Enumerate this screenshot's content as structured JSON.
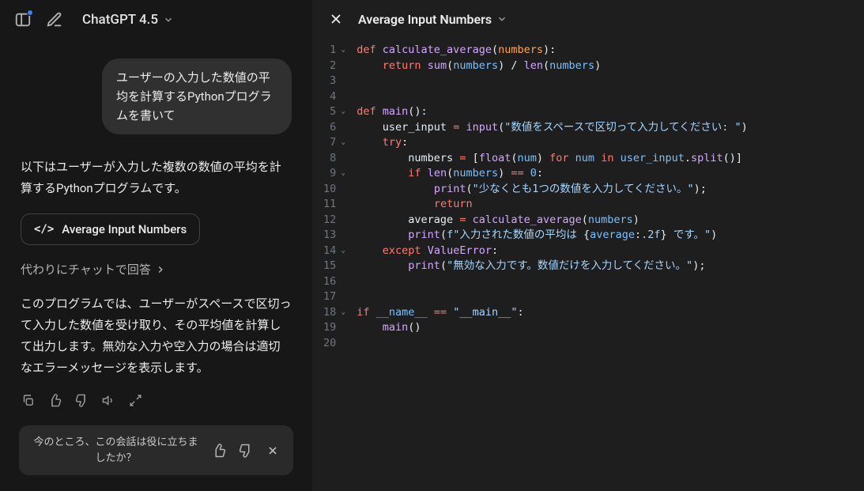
{
  "header": {
    "model": "ChatGPT 4.5"
  },
  "conversation": {
    "user_message": "ユーザーの入力した数値の平均を計算するPythonプログラムを書いて",
    "assistant_intro": "以下はユーザーが入力した複数の数値の平均を計算するPythonプログラムです。",
    "code_card_title": "Average Input Numbers",
    "chat_link": "代わりにチャットで回答",
    "assistant_desc": "このプログラムでは、ユーザーがスペースで区切って入力した数値を受け取り、その平均値を計算して出力します。無効な入力や空入力の場合は適切なエラーメッセージを表示します。"
  },
  "feedback": {
    "text": "今のところ、この会話は役に立ちましたか？"
  },
  "panel": {
    "title": "Average Input Numbers"
  },
  "code": {
    "lines": [
      {
        "n": 1,
        "fold": true,
        "tokens": [
          {
            "t": "def ",
            "c": "kw"
          },
          {
            "t": "calculate_average",
            "c": "fn"
          },
          {
            "t": "(",
            "c": "punc"
          },
          {
            "t": "numbers",
            "c": "param"
          },
          {
            "t": "):",
            "c": "punc"
          }
        ]
      },
      {
        "n": 2,
        "tokens": [
          {
            "t": "    ",
            "c": ""
          },
          {
            "t": "return ",
            "c": "kw"
          },
          {
            "t": "sum",
            "c": "fn"
          },
          {
            "t": "(",
            "c": "punc"
          },
          {
            "t": "numbers",
            "c": "var"
          },
          {
            "t": ") / ",
            "c": "punc"
          },
          {
            "t": "len",
            "c": "fn"
          },
          {
            "t": "(",
            "c": "punc"
          },
          {
            "t": "numbers",
            "c": "var"
          },
          {
            "t": ")",
            "c": "punc"
          }
        ]
      },
      {
        "n": 3,
        "tokens": []
      },
      {
        "n": 4,
        "tokens": []
      },
      {
        "n": 5,
        "fold": true,
        "tokens": [
          {
            "t": "def ",
            "c": "kw"
          },
          {
            "t": "main",
            "c": "fn"
          },
          {
            "t": "():",
            "c": "punc"
          }
        ]
      },
      {
        "n": 6,
        "tokens": [
          {
            "t": "    user_input ",
            "c": "name"
          },
          {
            "t": "= ",
            "c": "op"
          },
          {
            "t": "input",
            "c": "fn"
          },
          {
            "t": "(",
            "c": "punc"
          },
          {
            "t": "\"数値をスペースで区切って入力してください: \"",
            "c": "str"
          },
          {
            "t": ")",
            "c": "punc"
          }
        ]
      },
      {
        "n": 7,
        "fold": true,
        "tokens": [
          {
            "t": "    ",
            "c": ""
          },
          {
            "t": "try",
            "c": "kw"
          },
          {
            "t": ":",
            "c": "punc"
          }
        ]
      },
      {
        "n": 8,
        "tokens": [
          {
            "t": "        numbers ",
            "c": "name"
          },
          {
            "t": "= ",
            "c": "op"
          },
          {
            "t": "[",
            "c": "punc"
          },
          {
            "t": "float",
            "c": "fn"
          },
          {
            "t": "(",
            "c": "punc"
          },
          {
            "t": "num",
            "c": "var"
          },
          {
            "t": ") ",
            "c": "punc"
          },
          {
            "t": "for ",
            "c": "kw"
          },
          {
            "t": "num ",
            "c": "var"
          },
          {
            "t": "in ",
            "c": "kw"
          },
          {
            "t": "user_input",
            "c": "var"
          },
          {
            "t": ".",
            "c": "punc"
          },
          {
            "t": "split",
            "c": "fn"
          },
          {
            "t": "()]",
            "c": "punc"
          }
        ]
      },
      {
        "n": 9,
        "fold": true,
        "tokens": [
          {
            "t": "        ",
            "c": ""
          },
          {
            "t": "if ",
            "c": "kw"
          },
          {
            "t": "len",
            "c": "fn"
          },
          {
            "t": "(",
            "c": "punc"
          },
          {
            "t": "numbers",
            "c": "var"
          },
          {
            "t": ") ",
            "c": "punc"
          },
          {
            "t": "== ",
            "c": "op"
          },
          {
            "t": "0",
            "c": "num"
          },
          {
            "t": ":",
            "c": "punc"
          }
        ]
      },
      {
        "n": 10,
        "tokens": [
          {
            "t": "            ",
            "c": ""
          },
          {
            "t": "print",
            "c": "fn"
          },
          {
            "t": "(",
            "c": "punc"
          },
          {
            "t": "\"少なくとも1つの数値を入力してください。\"",
            "c": "str"
          },
          {
            "t": ");",
            "c": "punc"
          }
        ]
      },
      {
        "n": 11,
        "tokens": [
          {
            "t": "            ",
            "c": ""
          },
          {
            "t": "return",
            "c": "kw"
          }
        ]
      },
      {
        "n": 12,
        "tokens": [
          {
            "t": "        average ",
            "c": "name"
          },
          {
            "t": "= ",
            "c": "op"
          },
          {
            "t": "calculate_average",
            "c": "fn"
          },
          {
            "t": "(",
            "c": "punc"
          },
          {
            "t": "numbers",
            "c": "var"
          },
          {
            "t": ")",
            "c": "punc"
          }
        ]
      },
      {
        "n": 13,
        "tokens": [
          {
            "t": "        ",
            "c": ""
          },
          {
            "t": "print",
            "c": "fn"
          },
          {
            "t": "(",
            "c": "punc"
          },
          {
            "t": "f\"入力された数値の平均は ",
            "c": "str"
          },
          {
            "t": "{",
            "c": "punc"
          },
          {
            "t": "average",
            "c": "var"
          },
          {
            "t": ":",
            "c": "punc"
          },
          {
            "t": ".2f",
            "c": "str"
          },
          {
            "t": "}",
            "c": "punc"
          },
          {
            "t": " です。\"",
            "c": "str"
          },
          {
            "t": ")",
            "c": "punc"
          }
        ]
      },
      {
        "n": 14,
        "fold": true,
        "tokens": [
          {
            "t": "    ",
            "c": ""
          },
          {
            "t": "except ",
            "c": "kw"
          },
          {
            "t": "ValueError",
            "c": "fn"
          },
          {
            "t": ":",
            "c": "punc"
          }
        ]
      },
      {
        "n": 15,
        "tokens": [
          {
            "t": "        ",
            "c": ""
          },
          {
            "t": "print",
            "c": "fn"
          },
          {
            "t": "(",
            "c": "punc"
          },
          {
            "t": "\"無効な入力です。数値だけを入力してください。\"",
            "c": "str"
          },
          {
            "t": ");",
            "c": "punc"
          }
        ]
      },
      {
        "n": 16,
        "tokens": []
      },
      {
        "n": 17,
        "tokens": []
      },
      {
        "n": 18,
        "fold": true,
        "tokens": [
          {
            "t": "if ",
            "c": "kw"
          },
          {
            "t": "__name__ ",
            "c": "var"
          },
          {
            "t": "== ",
            "c": "op"
          },
          {
            "t": "\"__main__\"",
            "c": "str"
          },
          {
            "t": ":",
            "c": "punc"
          }
        ]
      },
      {
        "n": 19,
        "tokens": [
          {
            "t": "    ",
            "c": ""
          },
          {
            "t": "main",
            "c": "fn"
          },
          {
            "t": "()",
            "c": "punc"
          }
        ]
      },
      {
        "n": 20,
        "tokens": []
      }
    ]
  }
}
